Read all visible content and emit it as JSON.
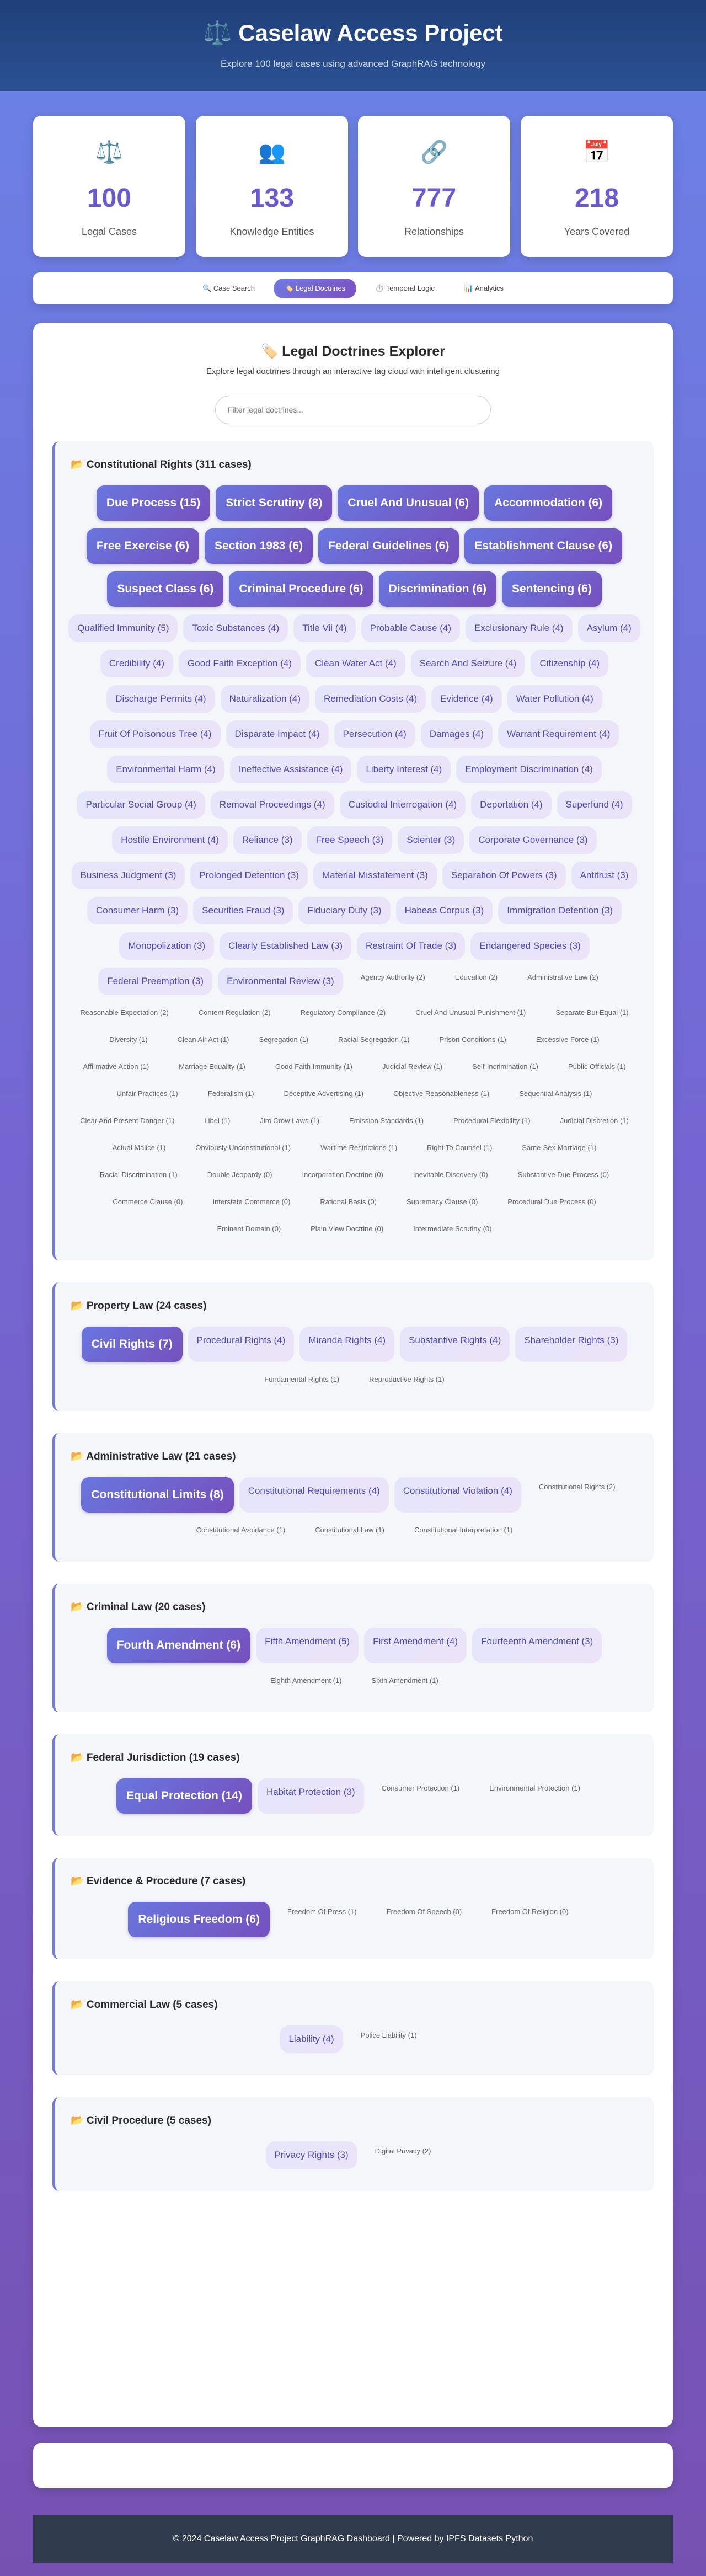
{
  "header": {
    "title": "⚖️ Caselaw Access Project",
    "subtitle": "Explore 100 legal cases using advanced GraphRAG technology"
  },
  "stats": [
    {
      "icon": "⚖️",
      "icon_name": "scales-icon",
      "value": "100",
      "label": "Legal Cases"
    },
    {
      "icon": "👥",
      "icon_name": "people-icon",
      "value": "133",
      "label": "Knowledge Entities"
    },
    {
      "icon": "🔗",
      "icon_name": "link-icon",
      "value": "777",
      "label": "Relationships"
    },
    {
      "icon": "📅",
      "icon_name": "calendar-icon",
      "value": "218",
      "label": "Years Covered"
    }
  ],
  "tabs": [
    {
      "label": "🔍 Case Search",
      "active": false
    },
    {
      "label": "🏷️ Legal Doctrines",
      "active": true
    },
    {
      "label": "⏱️ Temporal Logic",
      "active": false
    },
    {
      "label": "📊 Analytics",
      "active": false
    }
  ],
  "explorer": {
    "title": "🏷️ Legal Doctrines Explorer",
    "subtitle": "Explore legal doctrines through an interactive tag cloud with intelligent clustering",
    "filter_placeholder": "Filter legal doctrines..."
  },
  "categories": [
    {
      "heading": "📂 Constitutional Rights (311 cases)",
      "tags": [
        [
          "Due Process (15)",
          "l"
        ],
        [
          "Strict Scrutiny (8)",
          "l"
        ],
        [
          "Cruel And Unusual (6)",
          "l"
        ],
        [
          "Accommodation (6)",
          "l"
        ],
        [
          "Free Exercise (6)",
          "l"
        ],
        [
          "Section 1983 (6)",
          "l"
        ],
        [
          "Federal Guidelines (6)",
          "l"
        ],
        [
          "Establishment Clause (6)",
          "l"
        ],
        [
          "Suspect Class (6)",
          "l"
        ],
        [
          "Criminal Procedure (6)",
          "l"
        ],
        [
          "Discrimination (6)",
          "l"
        ],
        [
          "Sentencing (6)",
          "l"
        ],
        [
          "Qualified Immunity (5)",
          "m"
        ],
        [
          "Toxic Substances (4)",
          "m"
        ],
        [
          "Title Vii (4)",
          "m"
        ],
        [
          "Probable Cause (4)",
          "m"
        ],
        [
          "Exclusionary Rule (4)",
          "m"
        ],
        [
          "Asylum (4)",
          "m"
        ],
        [
          "Credibility (4)",
          "m"
        ],
        [
          "Good Faith Exception (4)",
          "m"
        ],
        [
          "Clean Water Act (4)",
          "m"
        ],
        [
          "Search And Seizure (4)",
          "m"
        ],
        [
          "Citizenship (4)",
          "m"
        ],
        [
          "Discharge Permits (4)",
          "m"
        ],
        [
          "Naturalization (4)",
          "m"
        ],
        [
          "Remediation Costs (4)",
          "m"
        ],
        [
          "Evidence (4)",
          "m"
        ],
        [
          "Water Pollution (4)",
          "m"
        ],
        [
          "Fruit Of Poisonous Tree (4)",
          "m"
        ],
        [
          "Disparate Impact (4)",
          "m"
        ],
        [
          "Persecution (4)",
          "m"
        ],
        [
          "Damages (4)",
          "m"
        ],
        [
          "Warrant Requirement (4)",
          "m"
        ],
        [
          "Environmental Harm (4)",
          "m"
        ],
        [
          "Ineffective Assistance (4)",
          "m"
        ],
        [
          "Liberty Interest (4)",
          "m"
        ],
        [
          "Employment Discrimination (4)",
          "m"
        ],
        [
          "Particular Social Group (4)",
          "m"
        ],
        [
          "Removal Proceedings (4)",
          "m"
        ],
        [
          "Custodial Interrogation (4)",
          "m"
        ],
        [
          "Deportation (4)",
          "m"
        ],
        [
          "Superfund (4)",
          "m"
        ],
        [
          "Hostile Environment (4)",
          "m"
        ],
        [
          "Reliance (3)",
          "m"
        ],
        [
          "Free Speech (3)",
          "m"
        ],
        [
          "Scienter (3)",
          "m"
        ],
        [
          "Corporate Governance (3)",
          "m"
        ],
        [
          "Business Judgment (3)",
          "m"
        ],
        [
          "Prolonged Detention (3)",
          "m"
        ],
        [
          "Material Misstatement (3)",
          "m"
        ],
        [
          "Separation Of Powers (3)",
          "m"
        ],
        [
          "Antitrust (3)",
          "m"
        ],
        [
          "Consumer Harm (3)",
          "m"
        ],
        [
          "Securities Fraud (3)",
          "m"
        ],
        [
          "Fiduciary Duty (3)",
          "m"
        ],
        [
          "Habeas Corpus (3)",
          "m"
        ],
        [
          "Immigration Detention (3)",
          "m"
        ],
        [
          "Monopolization (3)",
          "m"
        ],
        [
          "Clearly Established Law (3)",
          "m"
        ],
        [
          "Restraint Of Trade (3)",
          "m"
        ],
        [
          "Endangered Species (3)",
          "m"
        ],
        [
          "Federal Preemption (3)",
          "m"
        ],
        [
          "Environmental Review (3)",
          "m"
        ],
        [
          "Agency Authority (2)",
          "s"
        ],
        [
          "Education (2)",
          "s"
        ],
        [
          "Administrative Law (2)",
          "s"
        ],
        [
          "Reasonable Expectation (2)",
          "s"
        ],
        [
          "Content Regulation (2)",
          "s"
        ],
        [
          "Regulatory Compliance (2)",
          "s"
        ],
        [
          "Cruel And Unusual Punishment (1)",
          "s"
        ],
        [
          "Separate But Equal (1)",
          "s"
        ],
        [
          "Diversity (1)",
          "s"
        ],
        [
          "Clean Air Act (1)",
          "s"
        ],
        [
          "Segregation (1)",
          "s"
        ],
        [
          "Racial Segregation (1)",
          "s"
        ],
        [
          "Prison Conditions (1)",
          "s"
        ],
        [
          "Excessive Force (1)",
          "s"
        ],
        [
          "Affirmative Action (1)",
          "s"
        ],
        [
          "Marriage Equality (1)",
          "s"
        ],
        [
          "Good Faith Immunity (1)",
          "s"
        ],
        [
          "Judicial Review (1)",
          "s"
        ],
        [
          "Self-Incrimination (1)",
          "s"
        ],
        [
          "Public Officials (1)",
          "s"
        ],
        [
          "Unfair Practices (1)",
          "s"
        ],
        [
          "Federalism (1)",
          "s"
        ],
        [
          "Deceptive Advertising (1)",
          "s"
        ],
        [
          "Objective Reasonableness (1)",
          "s"
        ],
        [
          "Sequential Analysis (1)",
          "s"
        ],
        [
          "Clear And Present Danger (1)",
          "s"
        ],
        [
          "Libel (1)",
          "s"
        ],
        [
          "Jim Crow Laws (1)",
          "s"
        ],
        [
          "Emission Standards (1)",
          "s"
        ],
        [
          "Procedural Flexibility (1)",
          "s"
        ],
        [
          "Judicial Discretion (1)",
          "s"
        ],
        [
          "Actual Malice (1)",
          "s"
        ],
        [
          "Obviously Unconstitutional (1)",
          "s"
        ],
        [
          "Wartime Restrictions (1)",
          "s"
        ],
        [
          "Right To Counsel (1)",
          "s"
        ],
        [
          "Same-Sex Marriage (1)",
          "s"
        ],
        [
          "Racial Discrimination (1)",
          "s"
        ],
        [
          "Double Jeopardy (0)",
          "s"
        ],
        [
          "Incorporation Doctrine (0)",
          "s"
        ],
        [
          "Inevitable Discovery (0)",
          "s"
        ],
        [
          "Substantive Due Process (0)",
          "s"
        ],
        [
          "Commerce Clause (0)",
          "s"
        ],
        [
          "Interstate Commerce (0)",
          "s"
        ],
        [
          "Rational Basis (0)",
          "s"
        ],
        [
          "Supremacy Clause (0)",
          "s"
        ],
        [
          "Procedural Due Process (0)",
          "s"
        ],
        [
          "Eminent Domain (0)",
          "s"
        ],
        [
          "Plain View Doctrine (0)",
          "s"
        ],
        [
          "Intermediate Scrutiny (0)",
          "s"
        ]
      ]
    },
    {
      "heading": "📂 Property Law (24 cases)",
      "tags": [
        [
          "Civil Rights (7)",
          "l"
        ],
        [
          "Procedural Rights (4)",
          "m"
        ],
        [
          "Miranda Rights (4)",
          "m"
        ],
        [
          "Substantive Rights (4)",
          "m"
        ],
        [
          "Shareholder Rights (3)",
          "m"
        ],
        [
          "Fundamental Rights (1)",
          "s"
        ],
        [
          "Reproductive Rights (1)",
          "s"
        ]
      ]
    },
    {
      "heading": "📂 Administrative Law (21 cases)",
      "tags": [
        [
          "Constitutional Limits (8)",
          "l"
        ],
        [
          "Constitutional Requirements (4)",
          "m"
        ],
        [
          "Constitutional Violation (4)",
          "m"
        ],
        [
          "Constitutional Rights (2)",
          "s"
        ],
        [
          "Constitutional Avoidance (1)",
          "s"
        ],
        [
          "Constitutional Law (1)",
          "s"
        ],
        [
          "Constitutional Interpretation (1)",
          "s"
        ]
      ]
    },
    {
      "heading": "📂 Criminal Law (20 cases)",
      "tags": [
        [
          "Fourth Amendment (6)",
          "l"
        ],
        [
          "Fifth Amendment (5)",
          "m"
        ],
        [
          "First Amendment (4)",
          "m"
        ],
        [
          "Fourteenth Amendment (3)",
          "m"
        ],
        [
          "Eighth Amendment (1)",
          "s"
        ],
        [
          "Sixth Amendment (1)",
          "s"
        ]
      ]
    },
    {
      "heading": "📂 Federal Jurisdiction (19 cases)",
      "tags": [
        [
          "Equal Protection (14)",
          "l"
        ],
        [
          "Habitat Protection (3)",
          "m"
        ],
        [
          "Consumer Protection (1)",
          "s"
        ],
        [
          "Environmental Protection (1)",
          "s"
        ]
      ]
    },
    {
      "heading": "📂 Evidence & Procedure (7 cases)",
      "tags": [
        [
          "Religious Freedom (6)",
          "l"
        ],
        [
          "Freedom Of Press (1)",
          "s"
        ],
        [
          "Freedom Of Speech (0)",
          "s"
        ],
        [
          "Freedom Of Religion (0)",
          "s"
        ]
      ]
    },
    {
      "heading": "📂 Commercial Law (5 cases)",
      "tags": [
        [
          "Liability (4)",
          "m"
        ],
        [
          "Police Liability (1)",
          "s"
        ]
      ]
    },
    {
      "heading": "📂 Civil Procedure (5 cases)",
      "tags": [
        [
          "Privacy Rights (3)",
          "m"
        ],
        [
          "Digital Privacy (2)",
          "s"
        ]
      ]
    }
  ],
  "footer": {
    "text": "© 2024 Caselaw Access Project GraphRAG Dashboard | Powered by IPFS Datasets Python"
  }
}
